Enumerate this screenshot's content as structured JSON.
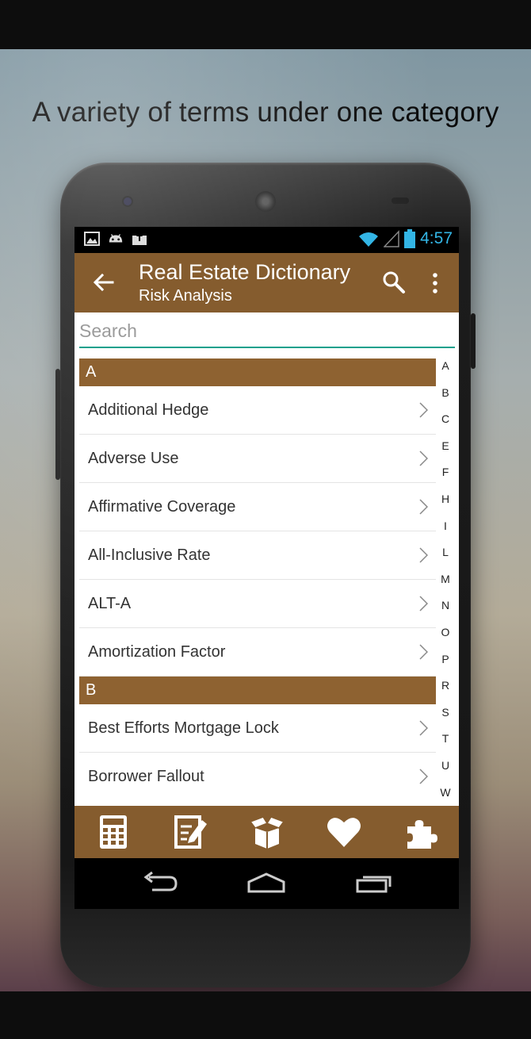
{
  "headline": "A variety of terms under one category",
  "status_bar": {
    "time": "4:57",
    "left_icons": [
      "image-icon",
      "android-icon",
      "upload-icon"
    ],
    "right_icons": [
      "wifi-icon",
      "signal-icon",
      "battery-icon"
    ]
  },
  "app_bar": {
    "title": "Real Estate Dictionary",
    "subtitle": "Risk Analysis"
  },
  "search": {
    "placeholder": "Search",
    "value": ""
  },
  "sections": [
    {
      "letter": "A",
      "items": [
        "Additional Hedge",
        "Adverse Use",
        "Affirmative Coverage",
        "All-Inclusive Rate",
        "ALT-A",
        "Amortization Factor"
      ]
    },
    {
      "letter": "B",
      "items": [
        "Best Efforts Mortgage Lock",
        "Borrower Fallout"
      ]
    }
  ],
  "alphabet_index": [
    "A",
    "B",
    "C",
    "E",
    "F",
    "H",
    "I",
    "L",
    "M",
    "N",
    "O",
    "P",
    "R",
    "S",
    "T",
    "U",
    "W"
  ],
  "bottom_nav": [
    "calculator-icon",
    "notes-icon",
    "box-icon",
    "heart-icon",
    "puzzle-icon"
  ],
  "system_nav": [
    "back-icon",
    "home-icon",
    "recents-icon"
  ],
  "colors": {
    "app_bar": "#855c2e",
    "section_header": "#8e6231",
    "search_underline": "#14a08c",
    "status_time": "#33b5e5"
  }
}
